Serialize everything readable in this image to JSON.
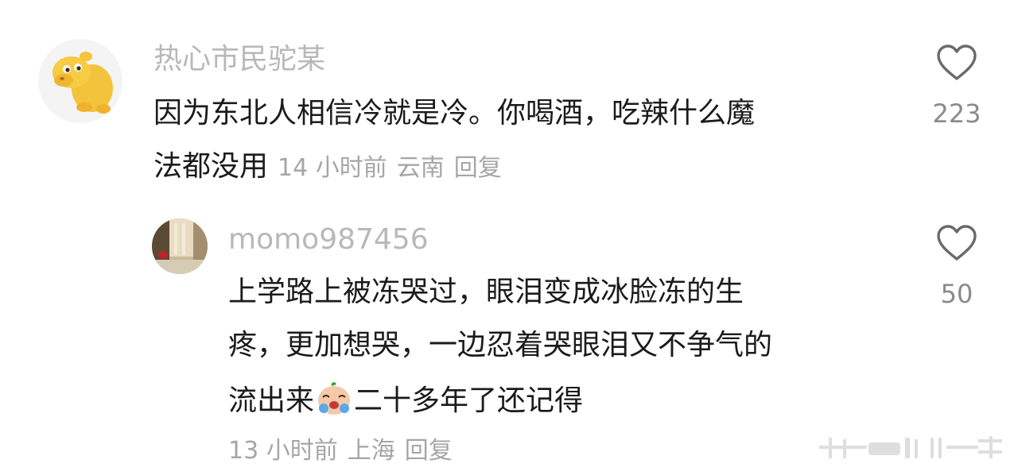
{
  "comments": [
    {
      "username": "热心市民驼某",
      "text_lines": [
        "因为东北人相信冷就是冷。你喝酒，吃辣什么魔",
        "法都没用"
      ],
      "time": "14 小时前",
      "location": "云南",
      "reply_label": "回复",
      "likes": "223",
      "avatar_icon": "yellow-creature-avatar"
    },
    {
      "username": "momo987456",
      "text_lines": [
        "上学路上被冻哭过，眼泪变成冰脸冻的生",
        "疼，更加想哭，一边忍着哭眼泪又不争气的",
        "流出来",
        "二十多年了还记得"
      ],
      "emoji_icon": "crying-face-emoji",
      "time": "13 小时前",
      "location": "上海",
      "reply_label": "回复",
      "likes": "50",
      "avatar_icon": "room-photo-avatar"
    }
  ],
  "colors": {
    "username": "#b8b8b8",
    "text": "#1b1b1b",
    "meta": "#a6a6a6",
    "like_icon": "#6a6a6a"
  }
}
